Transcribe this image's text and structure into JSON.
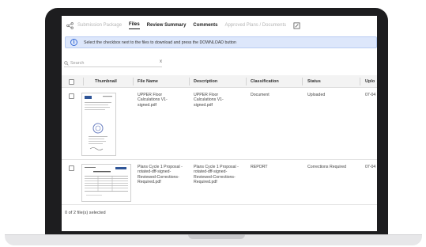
{
  "tabs": [
    {
      "label": "Submission Package",
      "state": "disabled"
    },
    {
      "label": "Files",
      "state": "active"
    },
    {
      "label": "Review Summary",
      "state": "bold"
    },
    {
      "label": "Comments",
      "state": "bold"
    },
    {
      "label": "Approved Plans / Documents",
      "state": "disabled"
    }
  ],
  "banner": {
    "icon": "info-icon",
    "text": "Select the checkbox next to the files to download and press the DOWNLOAD button"
  },
  "search": {
    "placeholder": "Search",
    "clear": "x"
  },
  "table": {
    "columns": [
      "Thumbnail",
      "File Name",
      "Description",
      "Classification",
      "Status",
      "Uplo"
    ],
    "rows": [
      {
        "file_name": "UPPER Floor Calculations V1-signed.pdf",
        "description": "UPPER Floor Calculations V1-signed.pdf",
        "classification": "Document",
        "status": "Uploaded",
        "uploaded": "07-04"
      },
      {
        "file_name": "Plans Cycle 1 Proposal - rotated-dff-signed-Reviewed-Corrections-Required.pdf",
        "description": "Plans Cycle 1 Proposal - rotated-dff-signed-Reviewed-Corrections-Required.pdf",
        "classification": "REPORT",
        "status": "Corrections Required",
        "uploaded": "07-04"
      }
    ]
  },
  "footer": {
    "selection": "0 of 2 file(s) selected"
  },
  "colors": {
    "banner_bg": "#dde7fb",
    "banner_border": "#b9ccf2",
    "info_blue": "#3b6fd8",
    "laptop": "#1d1d1f"
  }
}
